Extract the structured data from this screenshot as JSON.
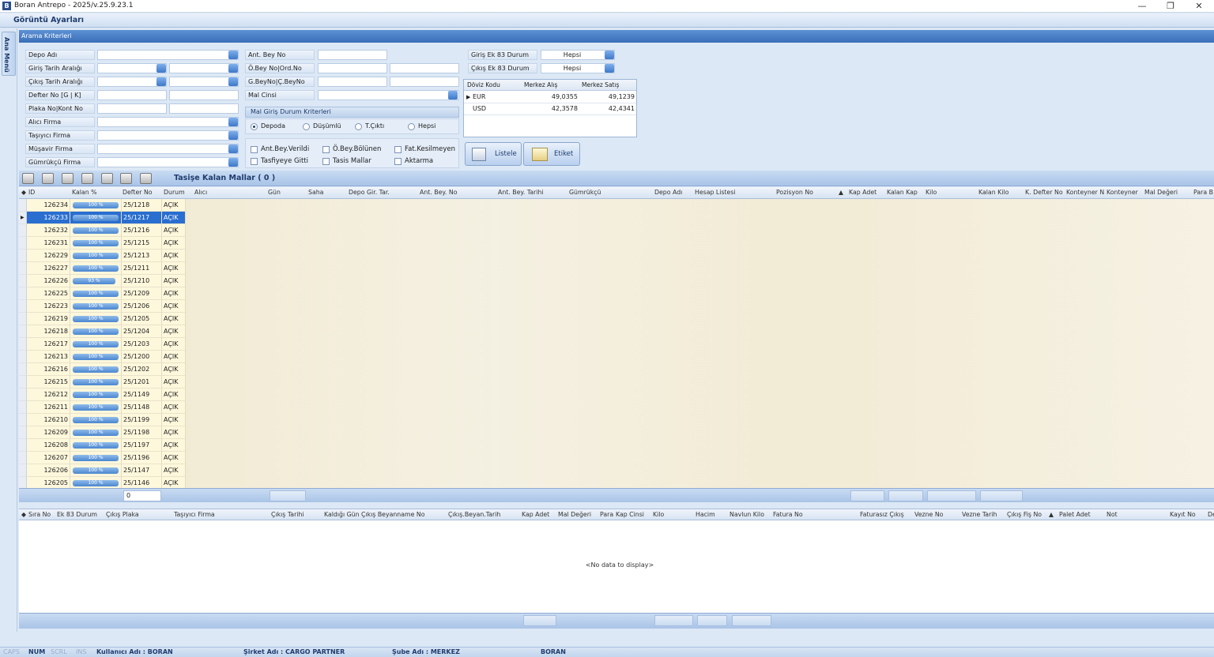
{
  "window": {
    "title": "Boran Antrepo - 2025/v.25.9.23.1",
    "icon": "B",
    "minimize": "—",
    "restore": "❐",
    "close": "✕"
  },
  "menu": {
    "view_settings": "Görüntü Ayarları"
  },
  "sidebar": {
    "main_menu": "Ana Menü"
  },
  "criteria": {
    "header": "Arama Kriterleri",
    "col1": [
      "Depo  Adı",
      "Giriş Tarih Aralığı",
      "Çıkış Tarih Aralığı",
      "Defter No [G | K]",
      "Plaka No|Kont No",
      "Alıcı Firma",
      "Taşıyıcı Firma",
      "Müşavir Firma",
      "Gümrükçü Firma"
    ],
    "col2": [
      "Ant. Bey No",
      "Ö.Bey No|Ord.No",
      "G.BeyNo|Ç.BeyNo",
      "Mal Cinsi"
    ],
    "mal_group": {
      "title": "Mal Giriş Durum Kriterleri",
      "radios": [
        "Depoda",
        "Düşümlü",
        "T.Çıktı",
        "Hepsi"
      ],
      "selected": "Depoda",
      "checks": [
        "Ant.Bey.Verildi",
        "Ö.Bey.Bölünen",
        "Fat.Kesilmeyen",
        "Tasfiyeye Gitti",
        "Tasis Mallar",
        "Aktarma"
      ]
    },
    "ek83": {
      "in_label": "Giriş Ek 83 Durum",
      "in_value": "Hepsi",
      "out_label": "Çıkış Ek 83 Durum",
      "out_value": "Hepsi"
    },
    "rates": {
      "headers": [
        "Döviz Kodu",
        "Merkez Alış",
        "Merkez Satış"
      ],
      "rows": [
        {
          "code": "EUR",
          "buy": "49,0355",
          "sell": "49,1239"
        },
        {
          "code": "USD",
          "buy": "42,3578",
          "sell": "42,4341"
        }
      ]
    },
    "buttons": {
      "list": "Listele",
      "label": "Etiket"
    }
  },
  "grid": {
    "title": "Tasişe Kalan Mallar ( 0 )",
    "columns": [
      "ID",
      "Kalan %",
      "Defter No",
      "Durum",
      "Alıcı",
      "Gün",
      "Saha",
      "Depo Gir. Tar.",
      "Ant. Bey. No",
      "Ant. Bey. Tarihi",
      "Gümrükçü",
      "Depo Adı",
      "Hesap Listesi",
      "Pozisyon No",
      "Kap Adet",
      "Kalan Kap",
      "Kilo",
      "Kalan Kilo",
      "K. Defter No",
      "Konteyner N",
      "Konteyner",
      "Mal Değeri",
      "Para B"
    ],
    "rows": [
      {
        "id": "126234",
        "pct": "100 %",
        "no": "25/1218",
        "st": "AÇIK"
      },
      {
        "id": "126233",
        "pct": "100 %",
        "no": "25/1217",
        "st": "AÇIK"
      },
      {
        "id": "126232",
        "pct": "100 %",
        "no": "25/1216",
        "st": "AÇIK"
      },
      {
        "id": "126231",
        "pct": "100 %",
        "no": "25/1215",
        "st": "AÇIK"
      },
      {
        "id": "126229",
        "pct": "100 %",
        "no": "25/1213",
        "st": "AÇIK"
      },
      {
        "id": "126227",
        "pct": "100 %",
        "no": "25/1211",
        "st": "AÇIK"
      },
      {
        "id": "126226",
        "pct": "93 %",
        "no": "25/1210",
        "st": "AÇIK"
      },
      {
        "id": "126225",
        "pct": "100 %",
        "no": "25/1209",
        "st": "AÇIK"
      },
      {
        "id": "126223",
        "pct": "100 %",
        "no": "25/1206",
        "st": "AÇIK"
      },
      {
        "id": "126219",
        "pct": "100 %",
        "no": "25/1205",
        "st": "AÇIK"
      },
      {
        "id": "126218",
        "pct": "100 %",
        "no": "25/1204",
        "st": "AÇIK"
      },
      {
        "id": "126217",
        "pct": "100 %",
        "no": "25/1203",
        "st": "AÇIK"
      },
      {
        "id": "126213",
        "pct": "100 %",
        "no": "25/1200",
        "st": "AÇIK"
      },
      {
        "id": "126216",
        "pct": "100 %",
        "no": "25/1202",
        "st": "AÇIK"
      },
      {
        "id": "126215",
        "pct": "100 %",
        "no": "25/1201",
        "st": "AÇIK"
      },
      {
        "id": "126212",
        "pct": "100 %",
        "no": "25/1149",
        "st": "AÇIK"
      },
      {
        "id": "126211",
        "pct": "100 %",
        "no": "25/1148",
        "st": "AÇIK"
      },
      {
        "id": "126210",
        "pct": "100 %",
        "no": "25/1199",
        "st": "AÇIK"
      },
      {
        "id": "126209",
        "pct": "100 %",
        "no": "25/1198",
        "st": "AÇIK"
      },
      {
        "id": "126208",
        "pct": "100 %",
        "no": "25/1197",
        "st": "AÇIK"
      },
      {
        "id": "126207",
        "pct": "100 %",
        "no": "25/1196",
        "st": "AÇIK"
      },
      {
        "id": "126206",
        "pct": "100 %",
        "no": "25/1147",
        "st": "AÇIK"
      },
      {
        "id": "126205",
        "pct": "100 %",
        "no": "25/1146",
        "st": "AÇIK"
      }
    ],
    "selected_index": 1,
    "footer_count": "0"
  },
  "grid2": {
    "columns": [
      "Sıra No",
      "Ek 83 Durum",
      "Çıkış Plaka",
      "Taşıyıcı Firma",
      "Çıkış Tarihi",
      "Kaldığı Gün",
      "Çıkış Beyanname No",
      "Çıkış.Beyan.Tarih",
      "Kap Adet",
      "Mal Değeri",
      "Para",
      "Kap Cinsi",
      "Kilo",
      "Hacim",
      "Navlun Kilo",
      "Fatura No",
      "Faturasız Çıkış",
      "Vezne No",
      "Vezne Tarih",
      "Çıkış Fiş No",
      "Palet Adet",
      "Not",
      "Kayıt No",
      "De"
    ],
    "empty": "<No data to display>"
  },
  "status": {
    "caps": "CAPS",
    "num": "NUM",
    "scrl": "SCRL",
    "ins": "INS",
    "user": "Kullanıcı Adı : BORAN",
    "company": "Şirket Adı    : CARGO PARTNER",
    "branch": "Şube Adı     : MERKEZ",
    "app": "BORAN"
  }
}
